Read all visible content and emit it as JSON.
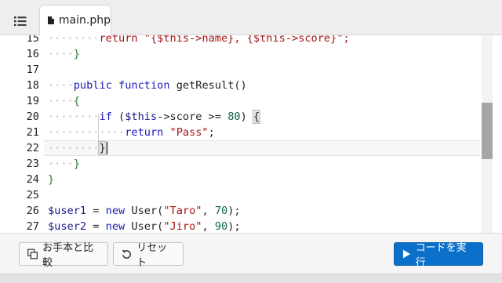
{
  "tab": {
    "filename": "main.php"
  },
  "editor": {
    "line_numbers": [
      "15",
      "16",
      "17",
      "18",
      "19",
      "20",
      "21",
      "22",
      "23",
      "24",
      "25",
      "26",
      "27"
    ],
    "lines": {
      "l15": {
        "code": "return \"{$this->name}, {$this->score}\";"
      },
      "l16": {
        "brace": "}"
      },
      "l18": {
        "kw1": "public",
        "kw2": "function",
        "name": "getResult()"
      },
      "l19": {
        "brace": "{"
      },
      "l20": {
        "kw": "if",
        "pre": " (",
        "var": "$this",
        "mid": "->score >= ",
        "num": "80",
        "post": ") ",
        "brace": "{"
      },
      "l21": {
        "kw": "return",
        "str": "\"Pass\"",
        "post": ";"
      },
      "l22": {
        "brace": "}"
      },
      "l23": {
        "brace": "}"
      },
      "l24": {
        "brace": "}"
      },
      "l26": {
        "var": "$user1",
        "eq": " = ",
        "kw": "new",
        "cls": " User(",
        "str": "\"Taro\"",
        "sep": ", ",
        "num": "70",
        "end": ");"
      },
      "l27": {
        "var": "$user2",
        "eq": " = ",
        "kw": "new",
        "cls": " User(",
        "str": "\"Jiro\"",
        "sep": ", ",
        "num": "90",
        "end": ");"
      }
    }
  },
  "toolbar": {
    "compare_label": "お手本と比較",
    "reset_label": "リセット",
    "run_label": "コードを実行"
  },
  "colors": {
    "accent": "#0b70c9"
  }
}
